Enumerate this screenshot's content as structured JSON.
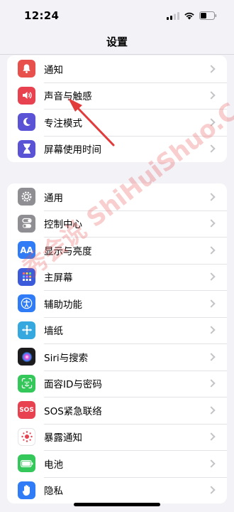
{
  "status_bar": {
    "time": "12:24"
  },
  "nav": {
    "title": "设置"
  },
  "groups": [
    [
      {
        "label": "通知",
        "icon": "bell-icon",
        "color": "#e8504c"
      },
      {
        "label": "声音与触感",
        "icon": "speaker-icon",
        "color": "#e8414f"
      },
      {
        "label": "专注模式",
        "icon": "moon-icon",
        "color": "#5b53d6"
      },
      {
        "label": "屏幕使用时间",
        "icon": "hourglass-icon",
        "color": "#5b53d6"
      }
    ],
    [
      {
        "label": "通用",
        "icon": "gear-icon",
        "color": "#8e8e93"
      },
      {
        "label": "控制中心",
        "icon": "toggles-icon",
        "color": "#8e8e93"
      },
      {
        "label": "显示与亮度",
        "icon": "text-size-icon",
        "color": "#2f7cf6"
      },
      {
        "label": "主屏幕",
        "icon": "home-grid-icon",
        "color": "#3b5bdb"
      },
      {
        "label": "辅助功能",
        "icon": "accessibility-icon",
        "color": "#2f7cf6"
      },
      {
        "label": "墙纸",
        "icon": "wallpaper-icon",
        "color": "#35a8e0"
      },
      {
        "label": "Siri与搜索",
        "icon": "siri-icon",
        "color": "#1c1c1e"
      },
      {
        "label": "面容ID与密码",
        "icon": "face-id-icon",
        "color": "#34c759"
      },
      {
        "label": "SOS紧急联络",
        "icon": "sos-icon",
        "color": "#e8414f"
      },
      {
        "label": "暴露通知",
        "icon": "exposure-icon",
        "color": "#ffffff"
      },
      {
        "label": "电池",
        "icon": "battery-icon",
        "color": "#34c759"
      },
      {
        "label": "隐私",
        "icon": "hand-icon",
        "color": "#2f7cf6"
      }
    ]
  ],
  "watermark": {
    "text": "秀会说 ShiHuiShuo.Com"
  }
}
